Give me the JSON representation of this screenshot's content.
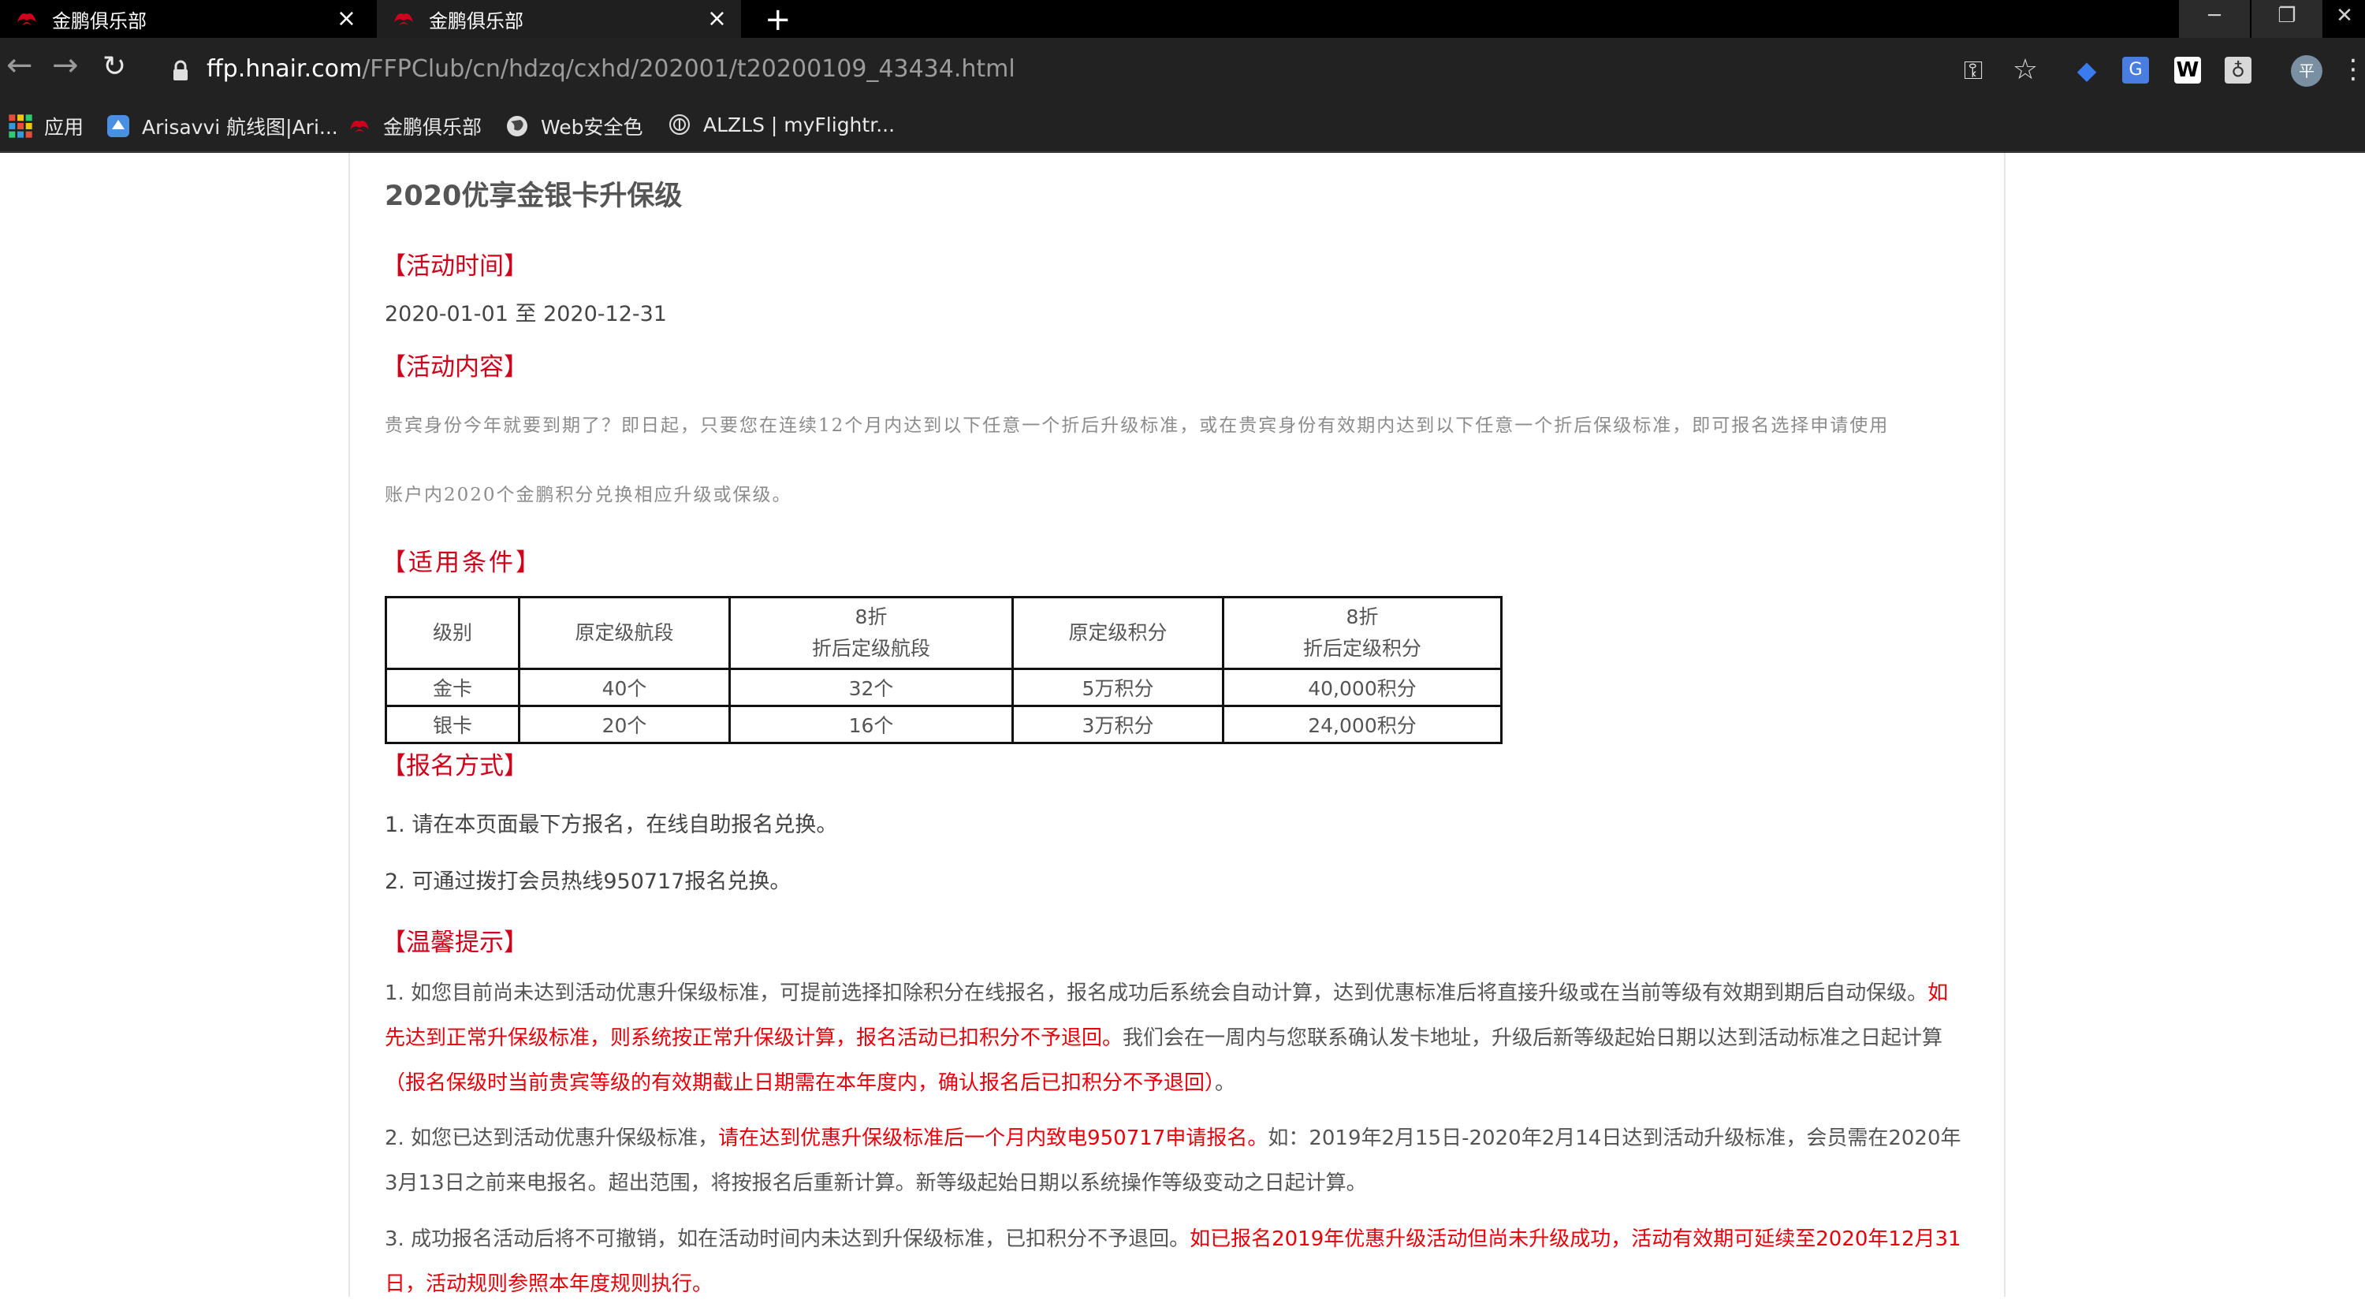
{
  "browser": {
    "tabs": [
      {
        "title": "金鹏俱乐部",
        "active": false
      },
      {
        "title": "金鹏俱乐部",
        "active": true
      }
    ],
    "url_host": "ffp.hnair.com",
    "url_path": "/FFPClub/cn/hdzq/cxhd/202001/t20200109_43434.html",
    "avatar_initial": "平",
    "bookmarks": [
      {
        "label": "应用",
        "icon": "apps-grid-icon"
      },
      {
        "label": "Arisavvi 航线图|Ari...",
        "icon": "arisavvi-icon"
      },
      {
        "label": "金鹏俱乐部",
        "icon": "jinpeng-logo-icon"
      },
      {
        "label": "Web安全色",
        "icon": "globe-icon"
      },
      {
        "label": "ALZLS | myFlightr...",
        "icon": "fingerprint-icon"
      }
    ]
  },
  "colors": {
    "accent_red": "#d0021b",
    "highlight_red": "#e8000b",
    "body_text": "#555555"
  },
  "article": {
    "title": "2020优享金银卡升保级",
    "time_heading": "【活动时间】",
    "date_range": "2020-01-01 至 2020-12-31",
    "content_heading": "【活动内容】",
    "content_line1": "贵宾身份今年就要到期了？即日起，只要您在连续12个月内达到以下任意一个折后升级标准，或在贵宾身份有效期内达到以下任意一个折后保级标准，即可报名选择申请使用",
    "content_line2": "账户内2020个金鹏积分兑换相应升级或保级。",
    "conditions_heading": "【适用条件】",
    "table": {
      "headers": [
        "级别",
        "原定级航段",
        "8折",
        "折后定级航段",
        "原定级积分",
        "8折",
        "折后定级积分"
      ],
      "rows": [
        [
          "金卡",
          "40个",
          "32个",
          "5万积分",
          "40,000积分"
        ],
        [
          "银卡",
          "20个",
          "16个",
          "3万积分",
          "24,000积分"
        ]
      ]
    },
    "signup_heading": "【报名方式】",
    "signup_1": "1. 请在本页面最下方报名，在线自助报名兑换。",
    "signup_2": "2. 可通过拨打会员热线950717报名兑换。",
    "tips_heading": "【温馨提示】",
    "tip1_a": "1. 如您目前尚未达到活动优惠升保级标准，可提前选择扣除积分在线报名，报名成功后系统会自动计算，达到优惠标准后将直接升级或在当前等级有效期到期后自动保级。",
    "tip1_b": "如先达到正常升保级标准，则系统按正常升保级计算，报名活动已扣积分不予退回。",
    "tip1_c": "我们会在一周内与您联系确认发卡地址，升级后新等级起始日期以达到活动标准之日起计算",
    "tip1_d": "（报名保级时当前贵宾等级的有效期截止日期需在本年度内，确认报名后已扣积分不予退回）",
    "tip1_e": "。",
    "tip2_a": "2. 如您已达到活动优惠升保级标准，",
    "tip2_b": "请在达到优惠升保级标准后一个月内致电950717申请报名。",
    "tip2_c": "如：2019年2月15日-2020年2月14日达到活动升级标准，会员需在2020年3月13日之前来电报名。超出范围，将按报名后重新计算。新等级起始日期以系统操作等级变动之日起计算。",
    "tip3_a": "3. 成功报名活动后将不可撤销，如在活动时间内未达到升保级标准，已扣积分不予退回。",
    "tip3_b": "如已报名2019年优惠升级活动但尚未升级成功，活动有效期可延续至2020年12月31日，活动规则参照本年度规则执行。"
  }
}
